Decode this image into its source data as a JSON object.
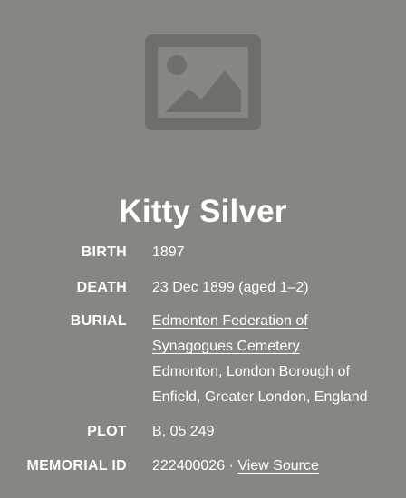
{
  "photo": {
    "icon": "image-placeholder-icon"
  },
  "memorial": {
    "name": "Kitty Silver"
  },
  "details": {
    "birth": {
      "label": "BIRTH",
      "value": "1897"
    },
    "death": {
      "label": "DEATH",
      "value": "23 Dec 1899 (aged 1–2)"
    },
    "burial": {
      "label": "BURIAL",
      "cemetery_line1": "Edmonton Federation of",
      "cemetery_line2": "Synagogues Cemetery",
      "location_line1": "Edmonton, London Borough of",
      "location_line2": "Enfield, Greater London, England"
    },
    "plot": {
      "label": "PLOT",
      "value": "B, 05 249"
    },
    "memorial_id": {
      "label": "MEMORIAL ID",
      "value": "222400026",
      "separator": "·",
      "view_source": "View Source"
    }
  },
  "colors": {
    "background": "#878681",
    "placeholder": "#6f6e6a",
    "text": "#ffffff"
  }
}
